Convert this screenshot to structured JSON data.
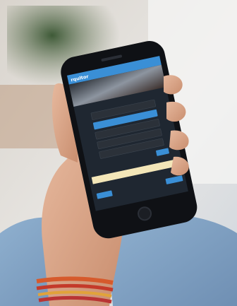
{
  "app": {
    "logo": "rqultor",
    "header_text": "",
    "hero_caption_lines": [
      "",
      ""
    ],
    "option_buttons": [
      {
        "label": "",
        "selected": false
      },
      {
        "label": "",
        "selected": true
      },
      {
        "label": "",
        "selected": false
      },
      {
        "label": "",
        "selected": false
      },
      {
        "label": "",
        "selected": false
      }
    ],
    "next_button": "",
    "notice_text": "",
    "footer_left_button": "",
    "footer_right_button": ""
  },
  "colors": {
    "accent_blue": "#3a8fd6",
    "app_bg": "#1f2731",
    "option_bg": "#2b3139",
    "notice_bg": "#f3e6b8",
    "phone_body": "#111317"
  }
}
